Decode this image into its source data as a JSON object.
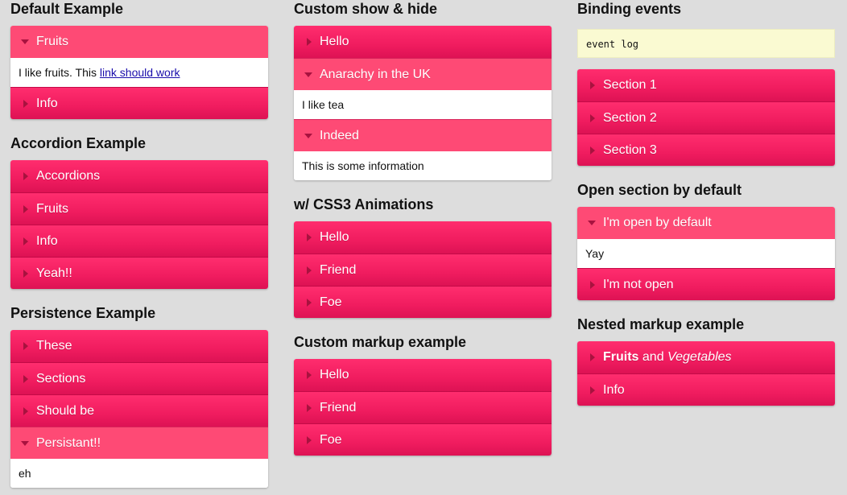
{
  "col1": {
    "default_example": {
      "title": "Default Example",
      "items": [
        {
          "label": "Fruits",
          "open": true,
          "content_prefix": "I like fruits. This ",
          "content_link": "link should work"
        },
        {
          "label": "Info",
          "open": false
        }
      ]
    },
    "accordion_example": {
      "title": "Accordion Example",
      "items": [
        {
          "label": "Accordions"
        },
        {
          "label": "Fruits"
        },
        {
          "label": "Info"
        },
        {
          "label": "Yeah!!"
        }
      ]
    },
    "persistence_example": {
      "title": "Persistence Example",
      "items": [
        {
          "label": "These"
        },
        {
          "label": "Sections"
        },
        {
          "label": "Should be"
        },
        {
          "label": "Persistant!!",
          "open": true,
          "content": "eh"
        }
      ]
    }
  },
  "col2": {
    "custom_show_hide": {
      "title": "Custom show & hide",
      "items": [
        {
          "label": "Hello"
        },
        {
          "label": "Anarachy in the UK",
          "open": true,
          "content": "I like tea"
        },
        {
          "label": "Indeed",
          "open": true,
          "content": "This is some information"
        }
      ]
    },
    "css3_animations": {
      "title": "w/ CSS3 Animations",
      "items": [
        {
          "label": "Hello"
        },
        {
          "label": "Friend"
        },
        {
          "label": "Foe"
        }
      ]
    },
    "custom_markup": {
      "title": "Custom markup example",
      "items": [
        {
          "label": "Hello"
        },
        {
          "label": "Friend"
        },
        {
          "label": "Foe"
        }
      ]
    }
  },
  "col3": {
    "binding_events": {
      "title": "Binding events",
      "event_log": "event log",
      "items": [
        {
          "label": "Section 1"
        },
        {
          "label": "Section 2"
        },
        {
          "label": "Section 3"
        }
      ]
    },
    "open_by_default": {
      "title": "Open section by default",
      "items": [
        {
          "label": "I'm open by default",
          "open": true,
          "content": "Yay"
        },
        {
          "label": "I'm not open"
        }
      ]
    },
    "nested_markup": {
      "title": "Nested markup example",
      "items": [
        {
          "label_bold": "Fruits",
          "label_mid": " and ",
          "label_italic": "Vegetables"
        },
        {
          "label": "Info"
        }
      ]
    }
  },
  "colors": {
    "background": "#dddddd",
    "summary": "#f01c5f",
    "summary_open": "#fe4a75",
    "arrow": "#a8123f",
    "event_log_bg": "#fafad2"
  }
}
